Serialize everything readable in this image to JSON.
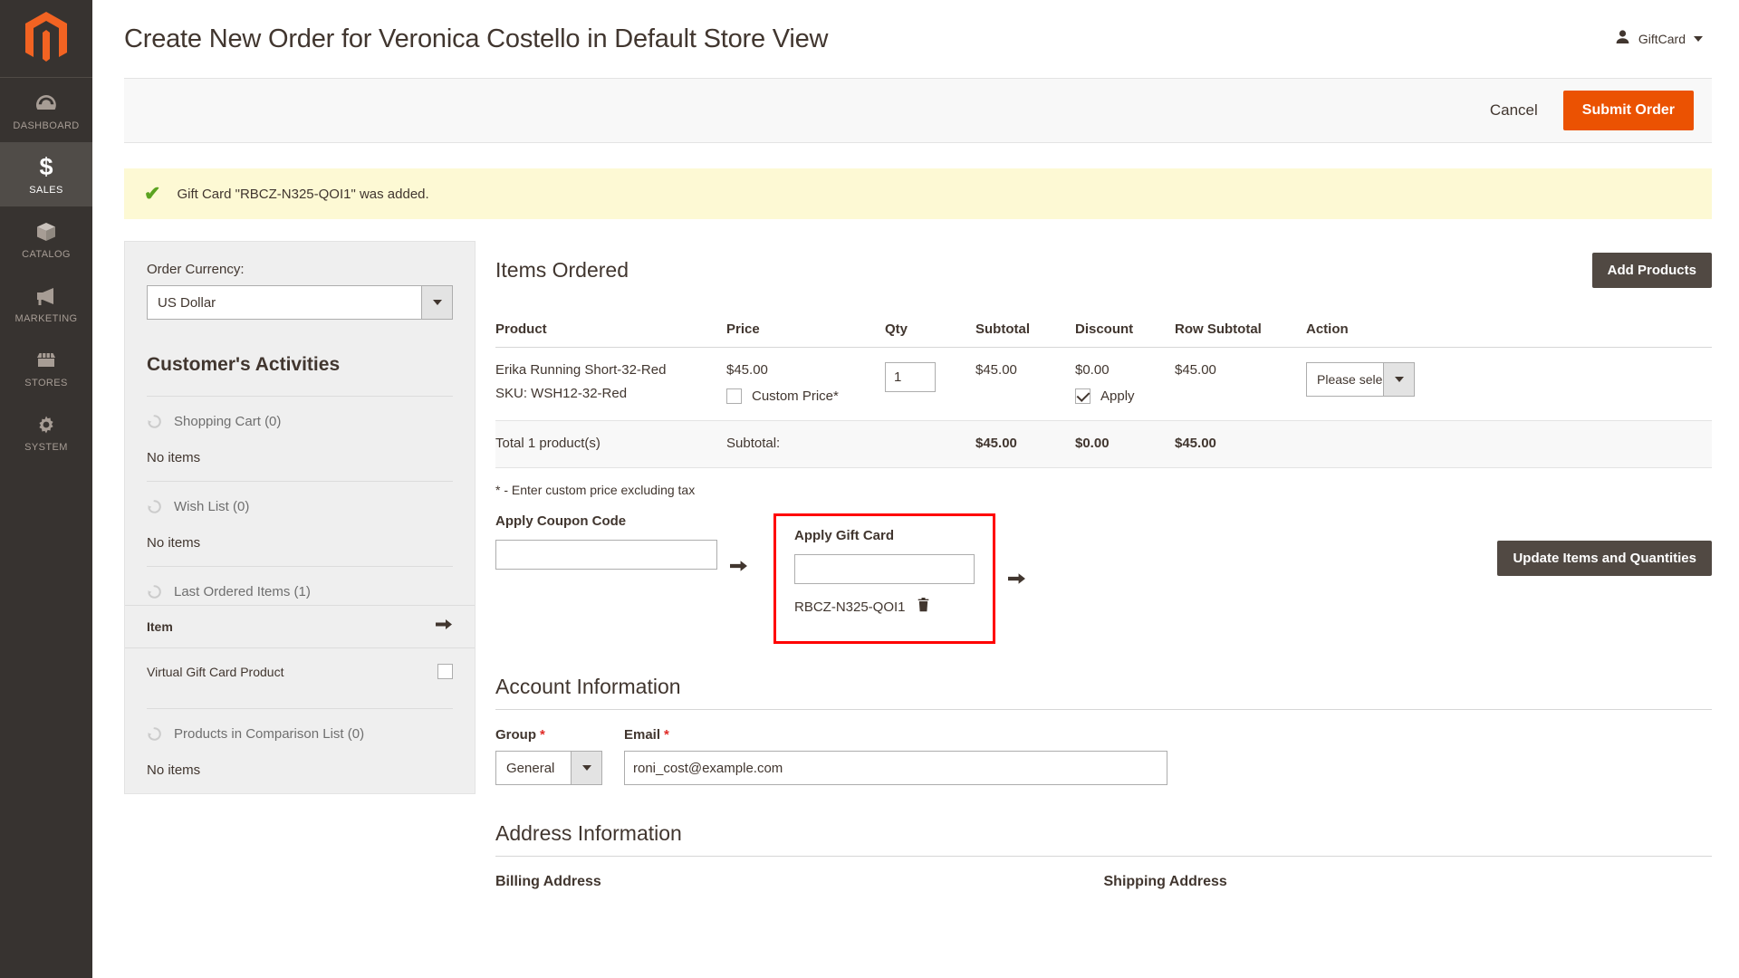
{
  "adminnav": {
    "logo": "magento-logo",
    "items": [
      {
        "label": "DASHBOARD",
        "icon": "dashboard-icon",
        "active": false
      },
      {
        "label": "SALES",
        "icon": "dollar-icon",
        "active": true
      },
      {
        "label": "CATALOG",
        "icon": "box-icon",
        "active": false
      },
      {
        "label": "MARKETING",
        "icon": "megaphone-icon",
        "active": false
      },
      {
        "label": "STORES",
        "icon": "storefront-icon",
        "active": false
      },
      {
        "label": "SYSTEM",
        "icon": "gear-icon",
        "active": false
      }
    ]
  },
  "header": {
    "title": "Create New Order for Veronica Costello in Default Store View",
    "user": "GiftCard"
  },
  "actions": {
    "cancel": "Cancel",
    "submit": "Submit Order"
  },
  "message": {
    "text": "Gift Card \"RBCZ-N325-QOI1\" was added."
  },
  "sidebar": {
    "currency_label": "Order Currency:",
    "currency_value": "US Dollar",
    "activities_title": "Customer's Activities",
    "blocks": [
      {
        "name": "Shopping Cart (0)",
        "empty": "No items"
      },
      {
        "name": "Wish List (0)",
        "empty": "No items"
      },
      {
        "name": "Last Ordered Items (1)"
      }
    ],
    "item_bar_label": "Item",
    "last_ordered_item": "Virtual Gift Card Product",
    "comparison": {
      "name": "Products in Comparison List (0)",
      "empty": "No items"
    }
  },
  "items": {
    "title": "Items Ordered",
    "add_products": "Add Products",
    "columns": [
      "Product",
      "Price",
      "Qty",
      "Subtotal",
      "Discount",
      "Row Subtotal",
      "Action"
    ],
    "rows": [
      {
        "product": "Erika Running Short-32-Red",
        "sku": "SKU: WSH12-32-Red",
        "price": "$45.00",
        "custom_price_label": "Custom Price*",
        "qty": "1",
        "subtotal": "$45.00",
        "discount": "$0.00",
        "apply_label": "Apply",
        "row_subtotal": "$45.00",
        "action_value": "Please select"
      }
    ],
    "totals": {
      "count": "Total 1 product(s)",
      "subtotal_label": "Subtotal:",
      "subtotal": "$45.00",
      "discount": "$0.00",
      "row_subtotal": "$45.00"
    },
    "note": "* - Enter custom price excluding tax"
  },
  "coupon": {
    "title": "Apply Coupon Code",
    "value": ""
  },
  "giftcard": {
    "title": "Apply Gift Card",
    "value": "",
    "applied_code": "RBCZ-N325-QOI1"
  },
  "update_button": "Update Items and Quantities",
  "account": {
    "title": "Account Information",
    "group_label": "Group",
    "group_value": "General",
    "email_label": "Email",
    "email_value": "roni_cost@example.com"
  },
  "address": {
    "title": "Address Information",
    "billing": "Billing Address",
    "shipping": "Shipping Address"
  },
  "colors": {
    "accent": "#eb5202",
    "nav_bg": "#373330",
    "highlight_box": "#ff0000",
    "success_bg": "#fdf9d4",
    "check": "#5ba321"
  }
}
